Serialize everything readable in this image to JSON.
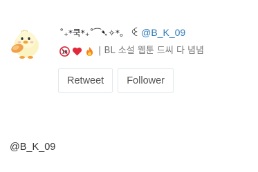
{
  "profile": {
    "display_name": "˚₊*쿡*₊˚⁀➷✧*。",
    "separator": "ꒊ",
    "handle": "@B_K_09",
    "bio_text": "| BL 소설 웹툰 드씨 다 념념",
    "bio_icons": [
      "age-18-icon",
      "red-heart-icon",
      "fire-icon"
    ]
  },
  "buttons": {
    "retweet_label": "Retweet",
    "follower_label": "Follower"
  },
  "footer": {
    "handle": "@B_K_09"
  }
}
